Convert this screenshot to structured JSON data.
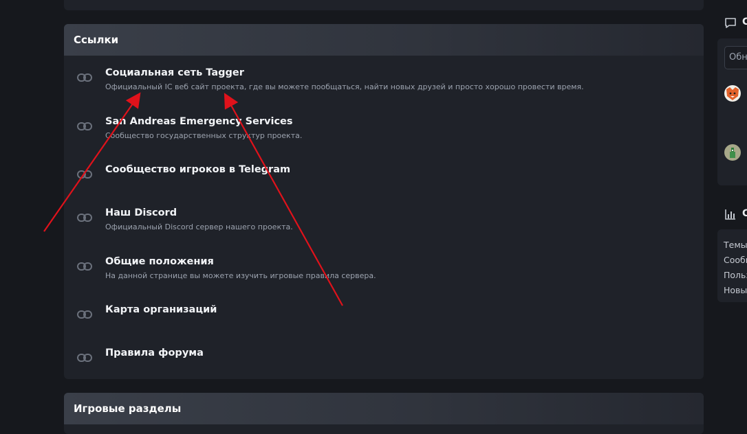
{
  "links_section": {
    "title": "Ссылки",
    "items": [
      {
        "title": "Социальная сеть Tagger",
        "description": "Официальный IC веб сайт проекта, где вы можете пообщаться, найти новых друзей и просто хорошо провести время."
      },
      {
        "title": "San Andreas Emergency Services",
        "description": "Сообщество государственных структур проекта."
      },
      {
        "title": "Сообщество игроков в Telegram",
        "description": ""
      },
      {
        "title": "Наш Discord",
        "description": "Официальный Discord сервер нашего проекта."
      },
      {
        "title": "Общие положения",
        "description": "На данной странице вы можете изучить игровые правила сервера."
      },
      {
        "title": "Карта организаций",
        "description": ""
      },
      {
        "title": "Правила форума",
        "description": ""
      }
    ]
  },
  "game_section": {
    "title": "Игровые разделы"
  },
  "sidebar": {
    "chat_widget": {
      "title": "С",
      "input_placeholder": "Обно"
    },
    "stats_widget": {
      "title": "С",
      "items": [
        "Темы",
        "Сообщ",
        "Польз",
        "Новы"
      ]
    }
  },
  "colors": {
    "background": "#16181d",
    "panel": "#1f2229",
    "header": "#3a3f49",
    "annotation_arrow": "#e0121b"
  },
  "icons": {
    "link": "link-icon",
    "chat": "chat-bubble-icon",
    "stats": "bar-chart-icon"
  }
}
